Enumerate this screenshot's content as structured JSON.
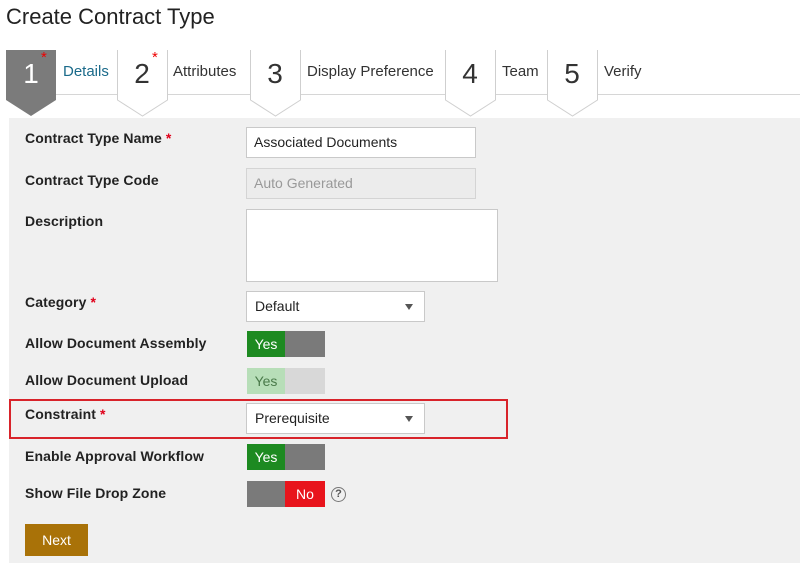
{
  "page": {
    "title": "Create Contract Type"
  },
  "wizard": {
    "steps": [
      {
        "number": "1",
        "label": "Details",
        "required_mark": "*"
      },
      {
        "number": "2",
        "label": "Attributes",
        "required_mark": "*"
      },
      {
        "number": "3",
        "label": "Display Preference"
      },
      {
        "number": "4",
        "label": "Team"
      },
      {
        "number": "5",
        "label": "Verify"
      }
    ],
    "active_step": 1
  },
  "form": {
    "contract_type_name": {
      "label": "Contract Type Name",
      "required_mark": "*",
      "value": "Associated Documents"
    },
    "contract_type_code": {
      "label": "Contract Type Code",
      "placeholder": "Auto Generated"
    },
    "description": {
      "label": "Description",
      "value": ""
    },
    "category": {
      "label": "Category",
      "required_mark": "*",
      "selected": "Default"
    },
    "allow_document_assembly": {
      "label": "Allow Document Assembly",
      "state": "Yes"
    },
    "allow_document_upload": {
      "label": "Allow Document Upload",
      "state": "Yes",
      "disabled": true
    },
    "constraint": {
      "label": "Constraint",
      "required_mark": "*",
      "selected": "Prerequisite"
    },
    "enable_approval_workflow": {
      "label": "Enable Approval Workflow",
      "state": "Yes"
    },
    "show_file_drop_zone": {
      "label": "Show File Drop Zone",
      "state": "No",
      "help": "?"
    }
  },
  "actions": {
    "next_label": "Next"
  },
  "colors": {
    "active_step": "#7b7b7b",
    "toggle_on": "#1d8a21",
    "toggle_off": "#e8141c",
    "next_button": "#a97208",
    "highlight": "#d8232a",
    "required": "#e0001a"
  },
  "icons": {
    "help": "question-circle-icon",
    "dropdown": "caret-down-icon"
  }
}
